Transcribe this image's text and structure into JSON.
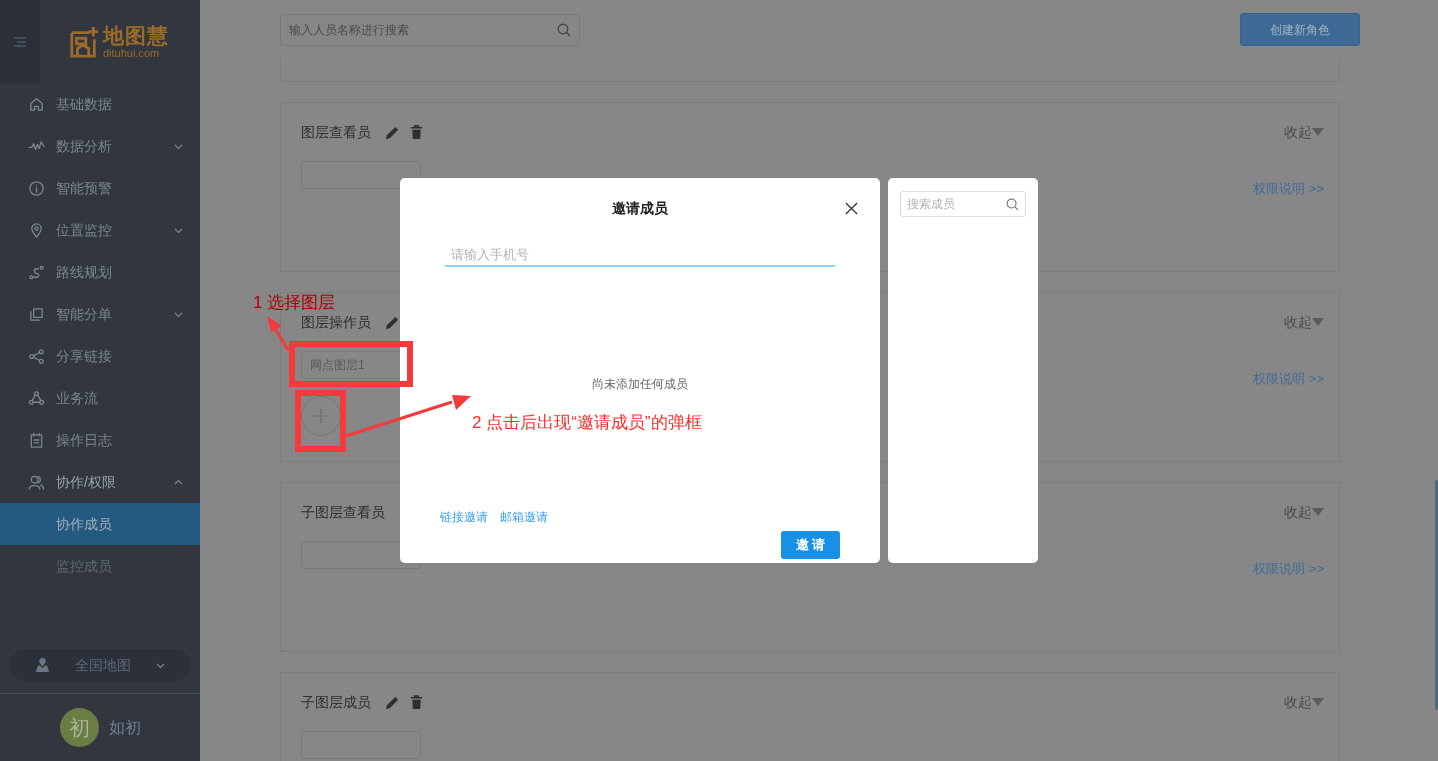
{
  "sidebar": {
    "logo": {
      "name": "地图慧",
      "domain": "dituhui.com"
    },
    "items": [
      {
        "label": "基础数据",
        "kind": "link"
      },
      {
        "label": "数据分析",
        "kind": "group",
        "expanded": false
      },
      {
        "label": "智能预警",
        "kind": "link"
      },
      {
        "label": "位置监控",
        "kind": "group",
        "expanded": false
      },
      {
        "label": "路线规划",
        "kind": "link"
      },
      {
        "label": "智能分单",
        "kind": "group",
        "expanded": false
      },
      {
        "label": "分享链接",
        "kind": "link"
      },
      {
        "label": "业务流",
        "kind": "link"
      },
      {
        "label": "操作日志",
        "kind": "link"
      },
      {
        "label": "协作/权限",
        "kind": "group",
        "expanded": true,
        "children": [
          {
            "label": "协作成员",
            "selected": true
          },
          {
            "label": "监控成员",
            "selected": false
          }
        ]
      }
    ],
    "map_selector": {
      "label": "全国地图"
    },
    "user": {
      "avatar_text": "初",
      "name": "如初"
    }
  },
  "main": {
    "search": {
      "placeholder": "输入人员名称进行搜索"
    },
    "create_button": "创建新角色",
    "roles": [
      {
        "title": "图层查看员",
        "edit_icon": true,
        "delete_icon": true,
        "dropdown_arrow": true,
        "collapse": "收起",
        "permission_link": "权限说明 >>",
        "add_button": false
      },
      {
        "title": "图层操作员",
        "edit_icon": true,
        "delete_icon": false,
        "dropdown_arrow": false,
        "select_value": "网点图层1",
        "collapse": "收起",
        "permission_link": "权限说明 >>",
        "add_button": true
      },
      {
        "title": "子图层查看员",
        "edit_icon": false,
        "delete_icon": false,
        "dropdown_arrow": false,
        "collapse": "收起",
        "permission_link": "权限说明 >>",
        "add_button": false
      },
      {
        "title": "子图层成员",
        "edit_icon": true,
        "delete_icon": true,
        "dropdown_arrow": true,
        "collapse": "收起",
        "add_button": false
      }
    ]
  },
  "dialog": {
    "title": "邀请成员",
    "phone_placeholder": "请输入手机号",
    "empty_text": "尚未添加任何成员",
    "links": [
      "链接邀请",
      "邮箱邀请"
    ],
    "invite_button": "邀 请"
  },
  "member_panel": {
    "search_placeholder": "搜索成员"
  },
  "annotations": [
    {
      "text": "1 选择图层"
    },
    {
      "text": "2 点击后出现“邀请成员”的弹框"
    }
  ]
}
